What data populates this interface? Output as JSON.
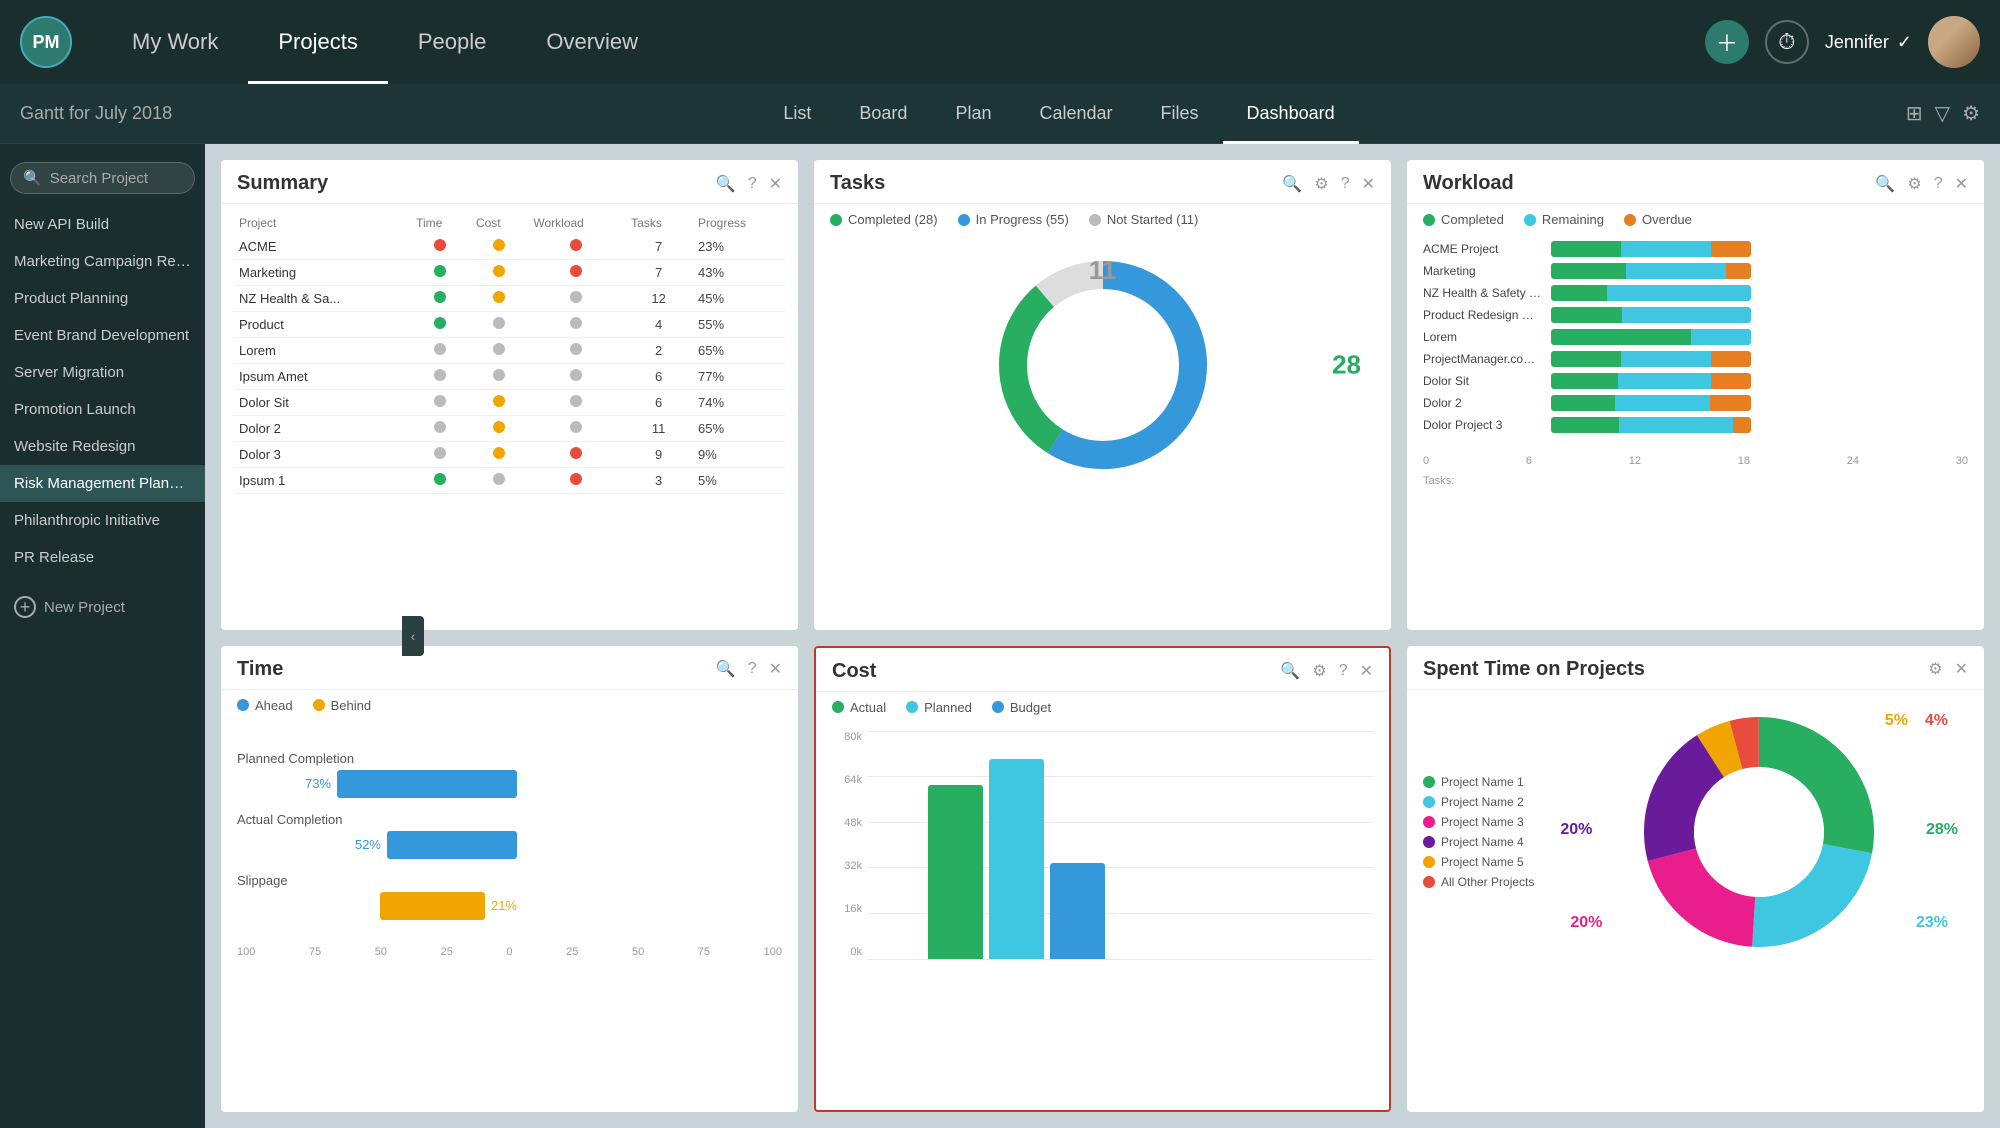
{
  "nav": {
    "logo": "PM",
    "links": [
      "My Work",
      "Projects",
      "People",
      "Overview"
    ],
    "active_link": "Projects",
    "user": "Jennifer",
    "icons": {
      "+": "add-icon",
      "⏱": "timer-icon",
      "✓": "check-icon"
    }
  },
  "sub_nav": {
    "gantt_label": "Gantt for July 2018",
    "links": [
      "List",
      "Board",
      "Plan",
      "Calendar",
      "Files",
      "Dashboard"
    ],
    "active_link": "Dashboard"
  },
  "sidebar": {
    "search_placeholder": "Search Project",
    "items": [
      {
        "label": "New API Build",
        "active": false
      },
      {
        "label": "Marketing Campaign Release",
        "active": false
      },
      {
        "label": "Product Planning",
        "active": false
      },
      {
        "label": "Event Brand Development",
        "active": false
      },
      {
        "label": "Server Migration",
        "active": false
      },
      {
        "label": "Promotion Launch",
        "active": false
      },
      {
        "label": "Website Redesign",
        "active": false
      },
      {
        "label": "Risk Management Planning",
        "active": true
      },
      {
        "label": "Philanthropic Initiative",
        "active": false
      },
      {
        "label": "PR Release",
        "active": false
      }
    ],
    "new_project_label": "New Project"
  },
  "summary": {
    "title": "Summary",
    "columns": [
      "Project",
      "Time",
      "Cost",
      "Workload",
      "Tasks",
      "Progress"
    ],
    "rows": [
      {
        "name": "ACME",
        "time": "red",
        "cost": "yellow",
        "workload": "red",
        "tasks": "7",
        "progress": "23%"
      },
      {
        "name": "Marketing",
        "time": "green",
        "cost": "yellow",
        "workload": "red",
        "tasks": "7",
        "progress": "43%"
      },
      {
        "name": "NZ Health & Sa...",
        "time": "green",
        "cost": "yellow",
        "workload": "gray",
        "tasks": "12",
        "progress": "45%"
      },
      {
        "name": "Product",
        "time": "green",
        "cost": "gray",
        "workload": "gray",
        "tasks": "4",
        "progress": "55%"
      },
      {
        "name": "Lorem",
        "time": "gray",
        "cost": "gray",
        "workload": "gray",
        "tasks": "2",
        "progress": "65%"
      },
      {
        "name": "Ipsum Amet",
        "time": "gray",
        "cost": "gray",
        "workload": "gray",
        "tasks": "6",
        "progress": "77%"
      },
      {
        "name": "Dolor Sit",
        "time": "gray",
        "cost": "yellow",
        "workload": "gray",
        "tasks": "6",
        "progress": "74%"
      },
      {
        "name": "Dolor 2",
        "time": "gray",
        "cost": "yellow",
        "workload": "gray",
        "tasks": "11",
        "progress": "65%"
      },
      {
        "name": "Dolor 3",
        "time": "gray",
        "cost": "yellow",
        "workload": "red",
        "tasks": "9",
        "progress": "9%"
      },
      {
        "name": "Ipsum 1",
        "time": "green",
        "cost": "gray",
        "workload": "red",
        "tasks": "3",
        "progress": "5%"
      }
    ]
  },
  "tasks": {
    "title": "Tasks",
    "legend": [
      {
        "label": "Completed (28)",
        "color": "#27ae60"
      },
      {
        "label": "In Progress (55)",
        "color": "#3498db"
      },
      {
        "label": "Not Started (11)",
        "color": "#bbb"
      }
    ],
    "completed": 28,
    "in_progress": 55,
    "not_started": 11,
    "donut": {
      "completed_pct": 30,
      "in_progress_pct": 59,
      "not_started_pct": 11
    }
  },
  "workload": {
    "title": "Workload",
    "legend": [
      {
        "label": "Completed",
        "color": "#27ae60"
      },
      {
        "label": "Remaining",
        "color": "#3fc6e0"
      },
      {
        "label": "Overdue",
        "color": "#e67e22"
      }
    ],
    "rows": [
      {
        "label": "ACME Project",
        "completed": 35,
        "remaining": 45,
        "overdue": 20
      },
      {
        "label": "Marketing",
        "completed": 30,
        "remaining": 40,
        "overdue": 10
      },
      {
        "label": "NZ Health & Safety De...",
        "completed": 25,
        "remaining": 65,
        "overdue": 0
      },
      {
        "label": "Product Redesign We...",
        "completed": 30,
        "remaining": 55,
        "overdue": 0
      },
      {
        "label": "Lorem",
        "completed": 70,
        "remaining": 30,
        "overdue": 0
      },
      {
        "label": "ProjectManager.com ...",
        "completed": 35,
        "remaining": 45,
        "overdue": 20
      },
      {
        "label": "Dolor Sit",
        "completed": 25,
        "remaining": 35,
        "overdue": 15
      },
      {
        "label": "Dolor 2",
        "completed": 28,
        "remaining": 42,
        "overdue": 18
      },
      {
        "label": "Dolor Project 3",
        "completed": 30,
        "remaining": 50,
        "overdue": 8
      }
    ],
    "x_axis": [
      "0",
      "6",
      "12",
      "18",
      "24",
      "30"
    ]
  },
  "time": {
    "title": "Time",
    "legend": [
      {
        "label": "Ahead",
        "color": "#3498db"
      },
      {
        "label": "Behind",
        "color": "#f0a500"
      }
    ],
    "rows": [
      {
        "label": "Planned Completion",
        "pct": 73,
        "color": "blue",
        "value": "73%"
      },
      {
        "label": "Actual Completion",
        "pct": 52,
        "color": "blue",
        "value": "52%"
      },
      {
        "label": "Slippage",
        "pct": 21,
        "color": "yellow",
        "value": "21%"
      }
    ],
    "x_axis": [
      "100",
      "75",
      "50",
      "25",
      "0",
      "25",
      "50",
      "75",
      "100"
    ]
  },
  "cost": {
    "title": "Cost",
    "highlighted": true,
    "legend": [
      {
        "label": "Actual",
        "color": "#27ae60"
      },
      {
        "label": "Planned",
        "color": "#3fc6e0"
      },
      {
        "label": "Budget",
        "color": "#3498db"
      }
    ],
    "y_axis": [
      "80k",
      "64k",
      "48k",
      "32k",
      "16k",
      "0k"
    ],
    "bars": [
      {
        "actual": 55,
        "planned": 0,
        "budget": 0
      },
      {
        "actual": 0,
        "planned": 80,
        "budget": 0
      },
      {
        "actual": 0,
        "planned": 0,
        "budget": 38
      }
    ]
  },
  "spent_time": {
    "title": "Spent Time on Projects",
    "legend": [
      {
        "label": "Project Name 1",
        "color": "#27ae60"
      },
      {
        "label": "Project Name 2",
        "color": "#3fc6e0"
      },
      {
        "label": "Project Name 3",
        "color": "#e91e8c"
      },
      {
        "label": "Project Name 4",
        "color": "#6a1b9a"
      },
      {
        "label": "Project Name 5",
        "color": "#f0a500"
      },
      {
        "label": "All Other Projects",
        "color": "#e74c3c"
      }
    ],
    "segments": [
      {
        "pct": 28,
        "color": "#27ae60",
        "label": "28%",
        "label_pos": "right"
      },
      {
        "pct": 23,
        "color": "#3fc6e0",
        "label": "23%",
        "label_pos": "bottom-right"
      },
      {
        "pct": 20,
        "color": "#e91e8c",
        "label": "20%",
        "label_pos": "bottom-left"
      },
      {
        "pct": 20,
        "color": "#6a1b9a",
        "label": "20%",
        "label_pos": "left"
      },
      {
        "pct": 5,
        "color": "#f0a500",
        "label": "5%",
        "label_pos": "top"
      },
      {
        "pct": 4,
        "color": "#e74c3c",
        "label": "4%",
        "label_pos": "top-right"
      }
    ]
  }
}
